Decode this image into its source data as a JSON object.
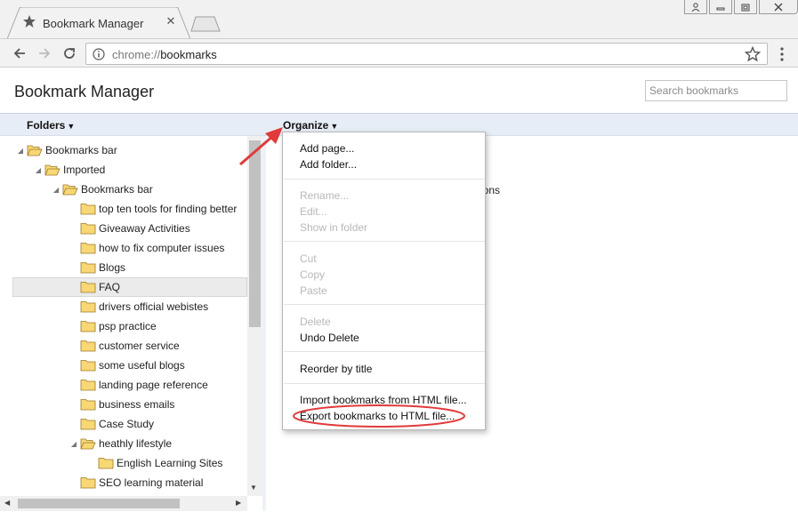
{
  "browser": {
    "tab_title": "Bookmark Manager",
    "url_scheme": "chrome://",
    "url_path": "bookmarks"
  },
  "page": {
    "title": "Bookmark Manager",
    "search_placeholder": "Search bookmarks"
  },
  "header_bar": {
    "folders_label": "Folders",
    "organize_label": "Organize"
  },
  "tree": [
    {
      "label": "Bookmarks bar",
      "expanded": true
    },
    {
      "label": "Imported",
      "expanded": true
    },
    {
      "label": "Bookmarks bar",
      "expanded": true
    },
    {
      "label": "top ten tools for finding better"
    },
    {
      "label": "Giveaway Activities"
    },
    {
      "label": "how to fix computer issues"
    },
    {
      "label": "Blogs"
    },
    {
      "label": "FAQ",
      "selected": true
    },
    {
      "label": "drivers official webistes"
    },
    {
      "label": "psp practice"
    },
    {
      "label": "customer service"
    },
    {
      "label": "some useful blogs"
    },
    {
      "label": "landing page reference"
    },
    {
      "label": "business emails"
    },
    {
      "label": "Case Study"
    },
    {
      "label": "heathly lifestyle",
      "expanded": true
    },
    {
      "label": "English Learning Sites"
    },
    {
      "label": "SEO learning material"
    }
  ],
  "behind_menu_text": "ions",
  "organize_menu": {
    "items": [
      {
        "label": "Add page...",
        "enabled": true
      },
      {
        "label": "Add folder...",
        "enabled": true
      },
      {
        "label": "Rename...",
        "enabled": false
      },
      {
        "label": "Edit...",
        "enabled": false
      },
      {
        "label": "Show in folder",
        "enabled": false
      },
      {
        "label": "Cut",
        "enabled": false
      },
      {
        "label": "Copy",
        "enabled": false
      },
      {
        "label": "Paste",
        "enabled": false
      },
      {
        "label": "Delete",
        "enabled": false
      },
      {
        "label": "Undo Delete",
        "enabled": true
      },
      {
        "label": "Reorder by title",
        "enabled": true
      },
      {
        "label": "Import bookmarks from HTML file...",
        "enabled": true
      },
      {
        "label": "Export bookmarks to HTML file...",
        "enabled": true
      }
    ]
  },
  "colors": {
    "header_bar": "#e7edf6",
    "folder_fill": "#f8d775",
    "annotation_red": "#e03a3a"
  }
}
